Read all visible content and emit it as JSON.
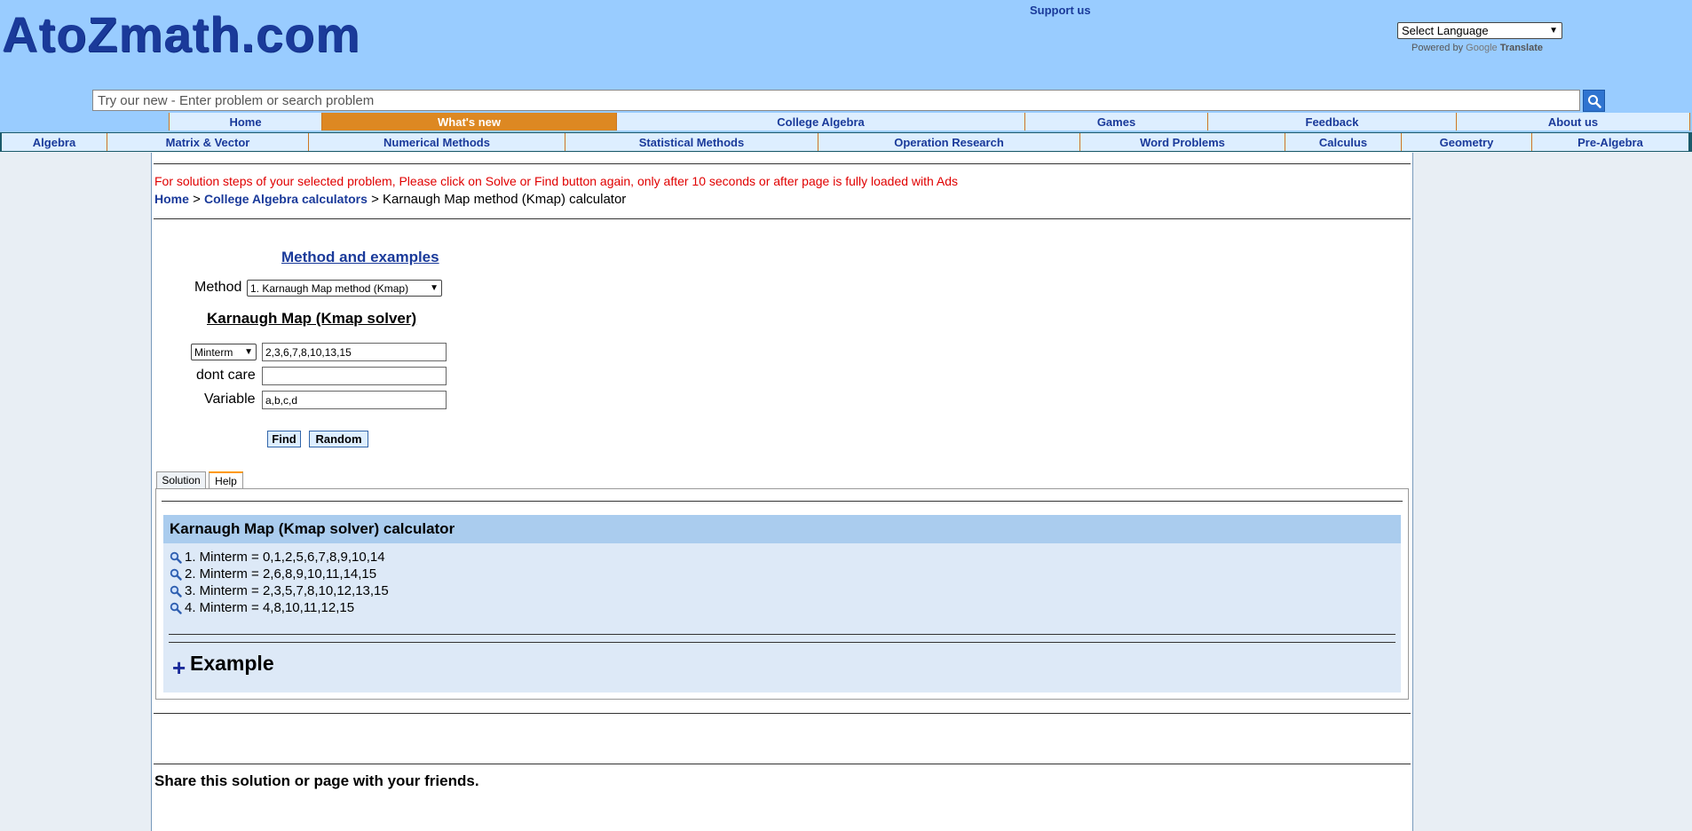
{
  "header": {
    "logo": "AtoZmath.com",
    "support_link": "Support us",
    "language_select": "Select Language",
    "powered_prefix": "Powered by",
    "powered_google": "Google",
    "powered_translate": "Translate"
  },
  "search": {
    "placeholder": "Try our new - Enter problem or search problem"
  },
  "nav_main": [
    {
      "label": "Home",
      "active": false
    },
    {
      "label": "What's new",
      "active": true
    },
    {
      "label": "College Algebra",
      "active": false
    },
    {
      "label": "Games",
      "active": false
    },
    {
      "label": "Feedback",
      "active": false
    },
    {
      "label": "About us",
      "active": false
    }
  ],
  "nav_sub": [
    "Algebra",
    "Matrix & Vector",
    "Numerical Methods",
    "Statistical Methods",
    "Operation Research",
    "Word Problems",
    "Calculus",
    "Geometry",
    "Pre-Algebra"
  ],
  "notice": "For solution steps of your selected problem, Please click on Solve or Find button again, only after 10 seconds or after page is fully loaded with Ads",
  "breadcrumb": {
    "home": "Home",
    "sep1": ">",
    "section": "College Algebra calculators",
    "sep2": ">",
    "current": "Karnaugh Map method (Kmap) calculator"
  },
  "form": {
    "method_link": "Method and examples",
    "method_label": "Method",
    "method_value": "1. Karnaugh Map method (Kmap)",
    "title": "Karnaugh Map (Kmap solver)",
    "term_type": "Minterm",
    "minterm_value": "2,3,6,7,8,10,13,15",
    "dontcare_label": "dont care",
    "dontcare_value": "",
    "variable_label": "Variable",
    "variable_value": "a,b,c,d",
    "find_button": "Find",
    "random_button": "Random"
  },
  "tabs": [
    {
      "label": "Solution",
      "active": false
    },
    {
      "label": "Help",
      "active": true
    }
  ],
  "help": {
    "title": "Karnaugh Map (Kmap solver) calculator",
    "examples": [
      "1. Minterm = 0,1,2,5,6,7,8,9,10,14",
      "2. Minterm = 2,6,8,9,10,11,14,15",
      "3. Minterm = 2,3,5,7,8,10,12,13,15",
      "4. Minterm = 4,8,10,11,12,15"
    ],
    "example_plus": "+",
    "example_heading": "Example"
  },
  "share_text": "Share this solution or page with your friends.",
  "colors": {
    "header_bg": "#99ccff",
    "nav_active": "#dd8822",
    "link": "#1a3a9a",
    "notice": "#e00000"
  }
}
